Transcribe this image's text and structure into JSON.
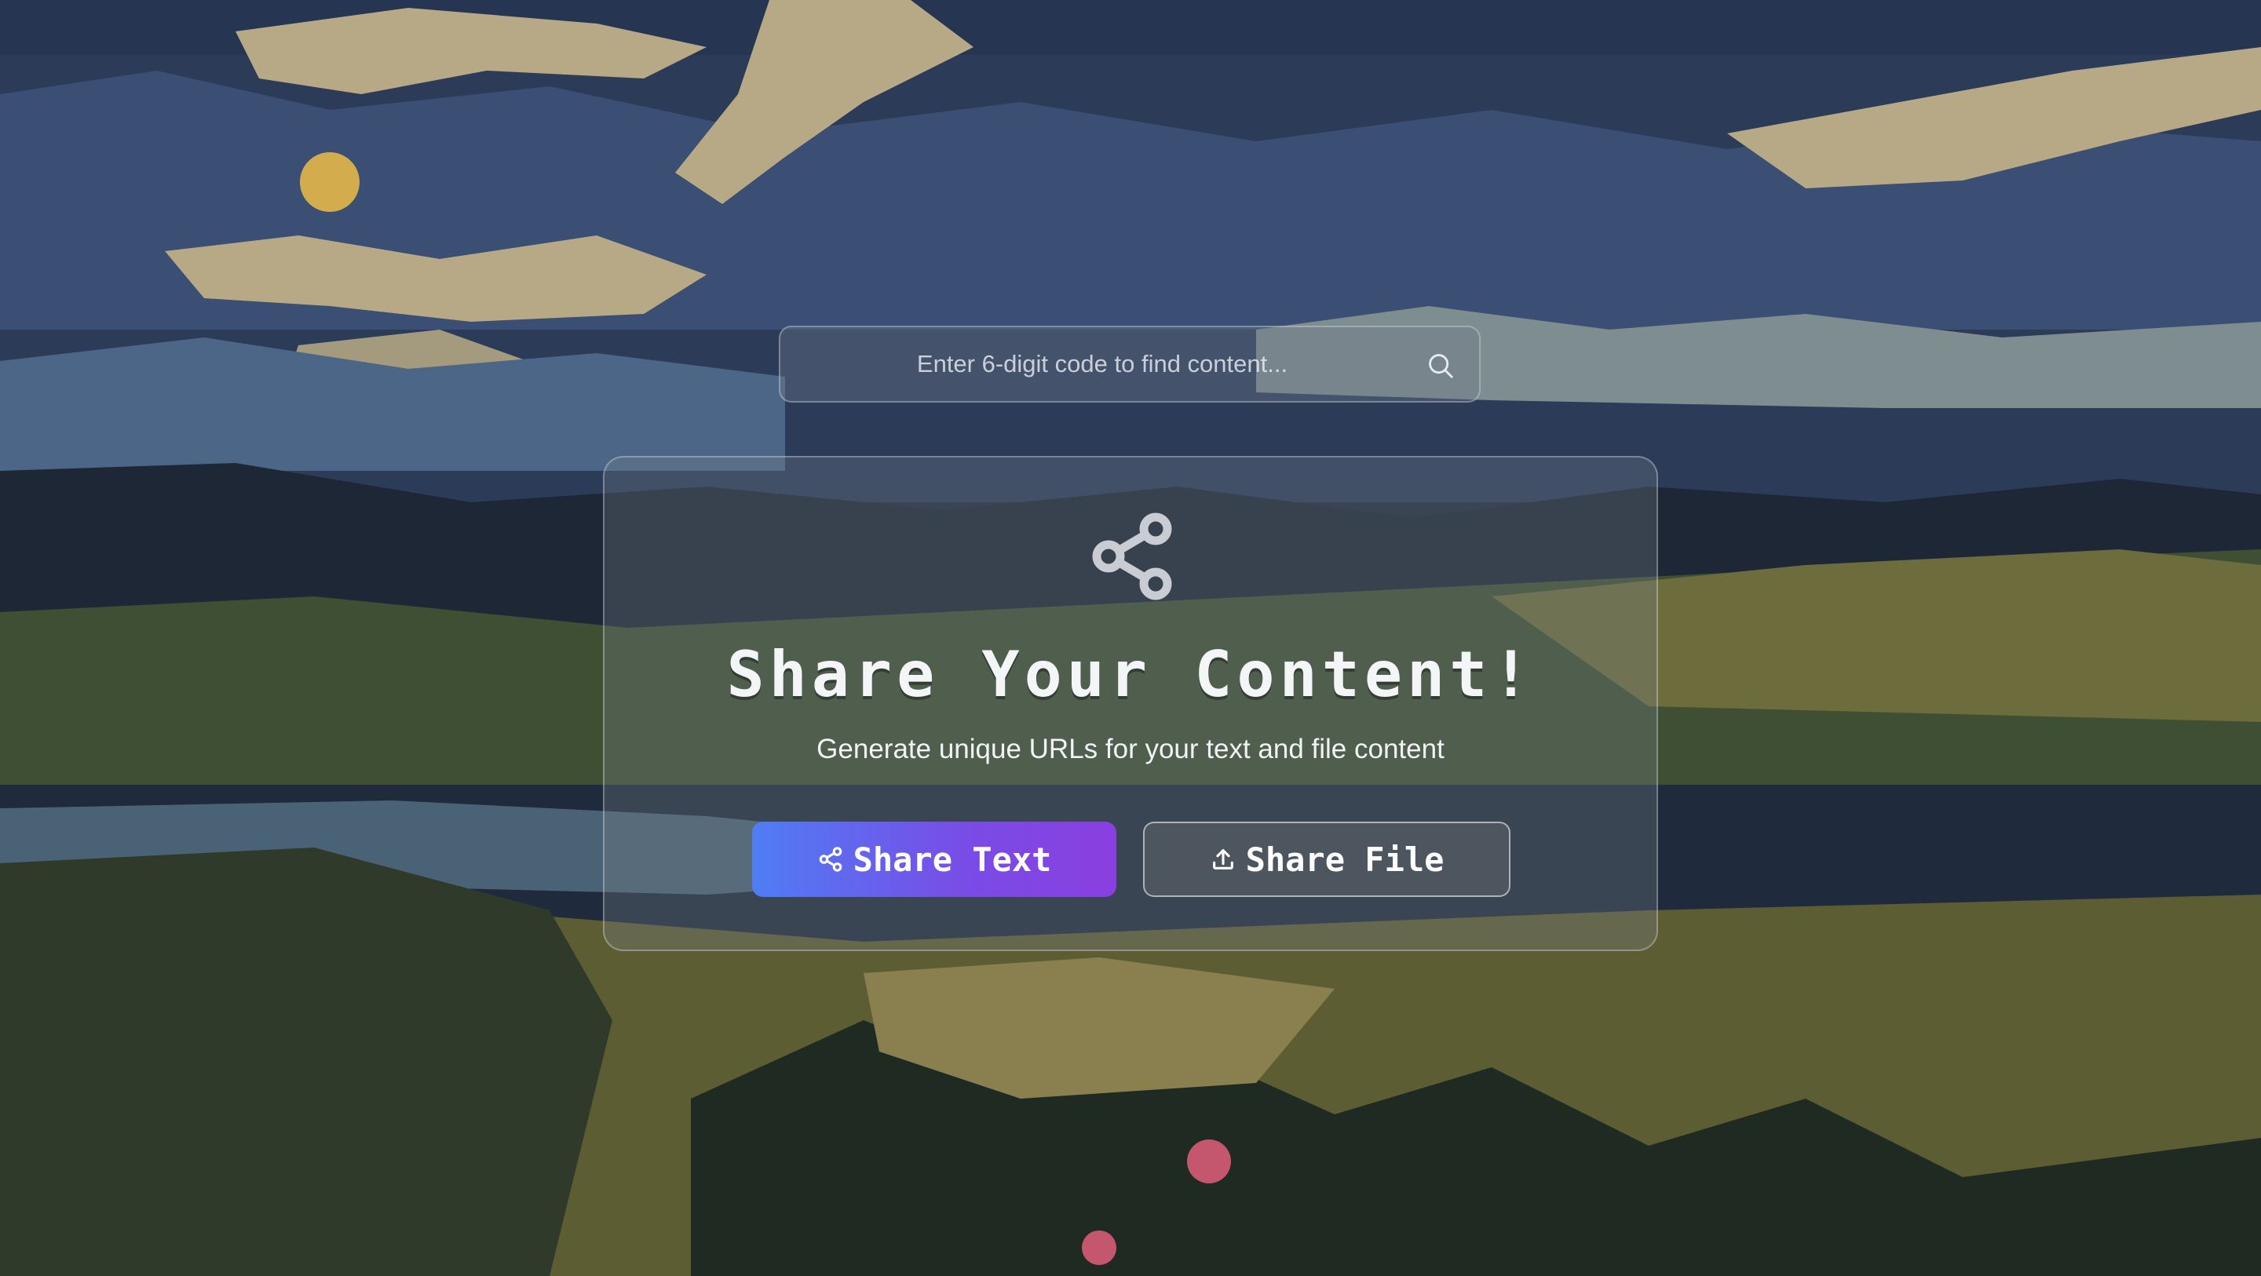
{
  "search": {
    "placeholder": "Enter 6-digit code to find content...",
    "icon": "search-icon"
  },
  "hero": {
    "icon": "share-icon",
    "title": "Share Your Content!",
    "subtitle": "Generate unique URLs for your text and file content"
  },
  "actions": {
    "share_text_label": "Share Text",
    "share_text_icon": "share-icon",
    "share_file_label": "Share File",
    "share_file_icon": "upload-icon"
  },
  "colors": {
    "primary_gradient_start": "#4f7df5",
    "primary_gradient_end": "#8a3fe0"
  }
}
